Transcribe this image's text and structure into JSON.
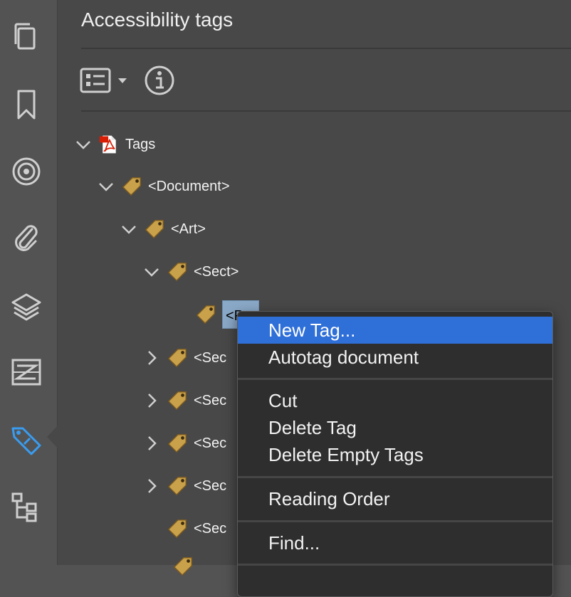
{
  "panel": {
    "title": "Accessibility tags"
  },
  "toolbar": {
    "options_icon": "list-options-icon",
    "dropdown_icon": "caret-down-icon",
    "info_icon": "info-icon"
  },
  "rail": {
    "icons": [
      "pages-icon",
      "bookmark-icon",
      "destinations-icon",
      "attachment-icon",
      "layers-icon",
      "content-icon",
      "tags-icon",
      "order-icon"
    ],
    "active": "tags-icon",
    "active_color": "#3a9cf0"
  },
  "tree": {
    "root": "Tags",
    "document": "<Document>",
    "art": "<Art>",
    "sect": "<Sect>",
    "p_selected": "<P",
    "sect_children": [
      "<Sec",
      "<Sec",
      "<Sec",
      "<Sec",
      "<Sec"
    ]
  },
  "menu": {
    "items": [
      "New Tag...",
      "Autotag document",
      "Cut",
      "Delete Tag",
      "Delete Empty Tags",
      "Reading Order",
      "Find..."
    ],
    "highlight_color": "#2f6fd8"
  }
}
